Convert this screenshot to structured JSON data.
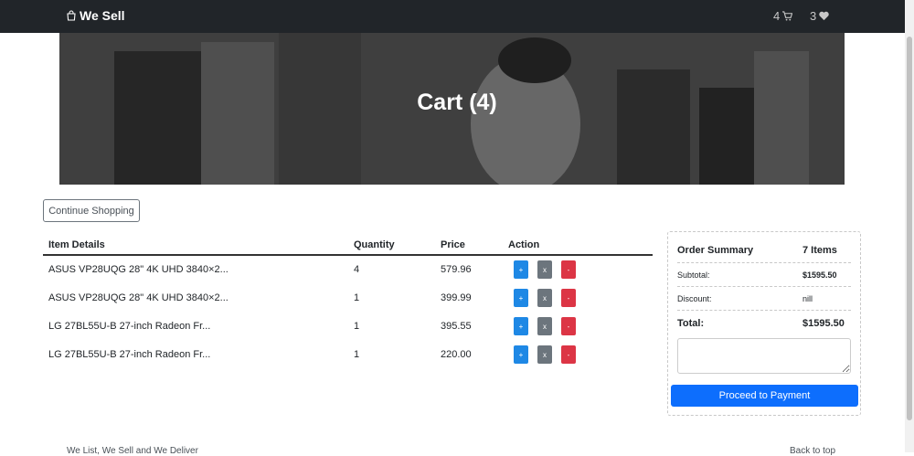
{
  "navbar": {
    "brand": "We Sell",
    "cart_count": "4",
    "wishlist_count": "3"
  },
  "hero": {
    "title": "Cart (4)"
  },
  "continue_label": "Continue Shopping",
  "cart_table": {
    "headers": [
      "Item Details",
      "Quantity",
      "Price",
      "Action"
    ],
    "rows": [
      {
        "name": "ASUS VP28UQG 28\" 4K UHD 3840×2...",
        "qty": "4",
        "price": "579.96"
      },
      {
        "name": "ASUS VP28UQG 28\" 4K UHD 3840×2...",
        "qty": "1",
        "price": "399.99"
      },
      {
        "name": "LG 27BL55U-B 27-inch Radeon Fr...",
        "qty": "1",
        "price": "395.55"
      },
      {
        "name": "LG 27BL55U-B 27-inch Radeon Fr...",
        "qty": "1",
        "price": "220.00"
      }
    ],
    "action_labels": {
      "add": "+",
      "remove": "x",
      "decrease": "-"
    }
  },
  "summary": {
    "title": "Order Summary",
    "items": "7 Items",
    "subtotal_label": "Subtotal:",
    "subtotal_value": "$1595.50",
    "discount_label": "Discount:",
    "discount_value": "nill",
    "total_label": "Total:",
    "total_value": "$1595.50",
    "pay_label": "Proceed to Payment"
  },
  "footer": {
    "left": "We List, We Sell and We Deliver",
    "right": "Back to top"
  },
  "colors": {
    "navbar": "#212529",
    "primary": "#0d6efd",
    "danger": "#dc3545",
    "secondary": "#6c757d"
  }
}
